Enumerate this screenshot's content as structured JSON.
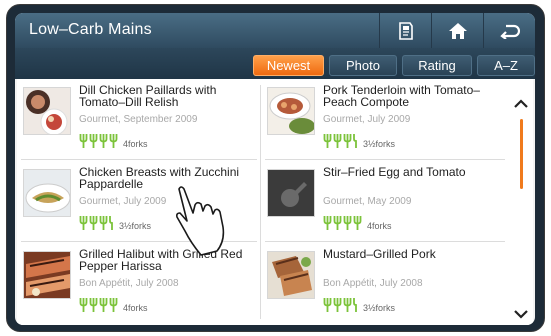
{
  "header": {
    "title": "Low–Carb Mains"
  },
  "top_buttons": [
    {
      "name": "recipe-card-icon"
    },
    {
      "name": "home-icon"
    },
    {
      "name": "back-icon"
    }
  ],
  "tabs": [
    {
      "label": "Newest",
      "active": true
    },
    {
      "label": "Photo",
      "active": false
    },
    {
      "label": "Rating",
      "active": false
    },
    {
      "label": "A–Z",
      "active": false
    }
  ],
  "recipes": [
    {
      "name": "Dill Chicken Paillards with Tomato–Dill Relish",
      "source": "Gourmet, September 2009",
      "forks": 4,
      "rating": "4forks"
    },
    {
      "name": "Pork Tenderloin with Tomato–Peach Compote",
      "source": "Gourmet, July 2009",
      "forks": 3.5,
      "rating": "3½forks"
    },
    {
      "name": "Chicken Breasts with Zucchini Pappardelle",
      "source": "Gourmet, July 2009",
      "forks": 3.5,
      "rating": "3½forks"
    },
    {
      "name": "Stir–Fried Egg and Tomato",
      "source": "Gourmet, May 2009",
      "forks": 4,
      "rating": "4forks"
    },
    {
      "name": "Grilled Halibut with Grilled Red Pepper Harissa",
      "source": "Bon Appétit, July 2008",
      "forks": 4,
      "rating": "4forks"
    },
    {
      "name": "Mustard–Grilled Pork",
      "source": "Bon Appétit, July 2008",
      "forks": 3.5,
      "rating": "3½forks"
    }
  ],
  "colors": {
    "accent": "#f07a1c",
    "fork": "#7cc33a",
    "header": "#3d5c72"
  },
  "scroll": {
    "up": "chevron-up-icon",
    "down": "chevron-down-icon"
  }
}
